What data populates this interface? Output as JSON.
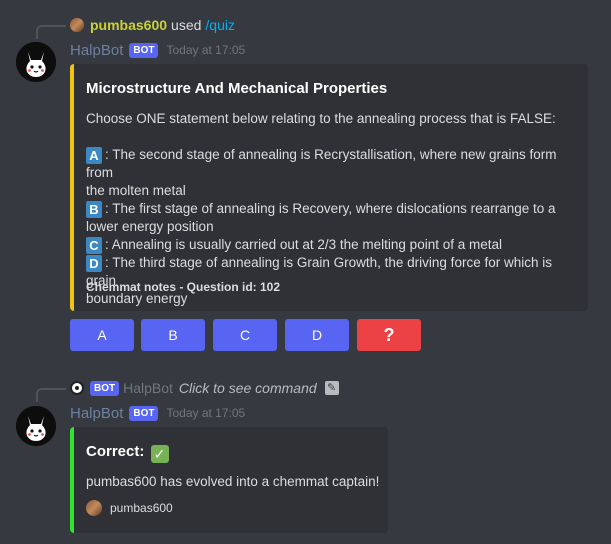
{
  "message1": {
    "reference": {
      "user": "pumbas600",
      "used": "used",
      "command": "/quiz"
    },
    "author": "HalpBot",
    "bot_tag": "BOT",
    "timestamp": "Today at 17:05",
    "embed": {
      "accent_color": "#f1c40f",
      "title": "Microstructure And Mechanical Properties",
      "prompt": "Choose ONE statement below relating to the annealing process that is FALSE:",
      "options": [
        {
          "letter": "A",
          "line1": ": The second stage of annealing is Recrystallisation, where new grains form from",
          "line2": "the molten metal"
        },
        {
          "letter": "B",
          "line1": ": The first stage of annealing is Recovery, where dislocations rearrange to a",
          "line2": "lower energy position"
        },
        {
          "letter": "C",
          "line1": ": Annealing is usually carried out at 2/3 the melting point of a metal",
          "line2": ""
        },
        {
          "letter": "D",
          "line1": ": The third stage of annealing is Grain Growth, the driving force for which is grain",
          "line2": "boundary energy"
        }
      ],
      "footer": "Chemmat notes - Question id: 102"
    },
    "buttons": [
      {
        "label": "A",
        "style": "primary"
      },
      {
        "label": "B",
        "style": "primary"
      },
      {
        "label": "C",
        "style": "primary"
      },
      {
        "label": "D",
        "style": "primary"
      },
      {
        "label": "?",
        "style": "danger"
      }
    ]
  },
  "message2": {
    "reference": {
      "bot_tag": "BOT",
      "user": "HalpBot",
      "click_text": "Click to see command"
    },
    "author": "HalpBot",
    "bot_tag": "BOT",
    "timestamp": "Today at 17:05",
    "embed": {
      "accent_color": "#2fe42f",
      "title": "Correct:",
      "description": "pumbas600 has evolved into a chemmat captain!",
      "footer": "pumbas600"
    }
  }
}
